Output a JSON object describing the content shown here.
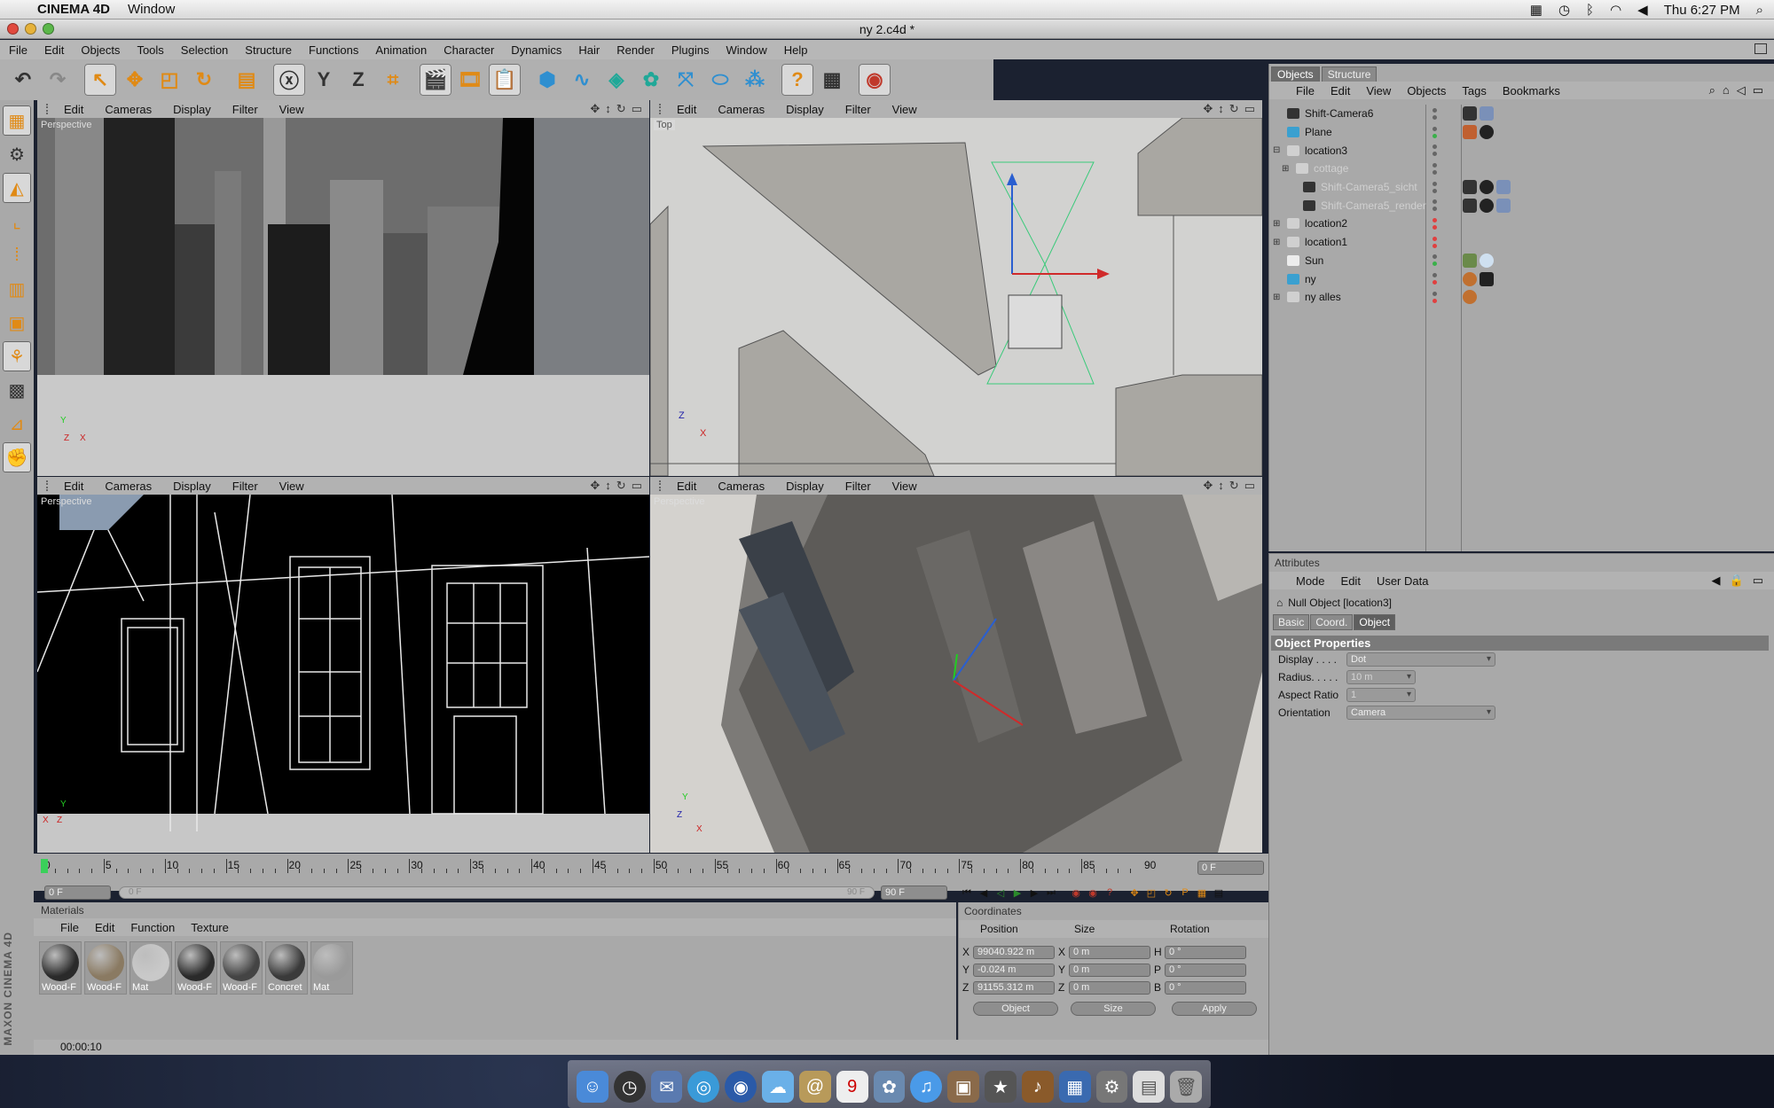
{
  "menubar": {
    "app_name": "CINEMA 4D",
    "items": [
      "Window"
    ],
    "clock": "Thu 6:27 PM"
  },
  "window": {
    "title": "ny 2.c4d *"
  },
  "app_menu": [
    "File",
    "Edit",
    "Objects",
    "Tools",
    "Selection",
    "Structure",
    "Functions",
    "Animation",
    "Character",
    "Dynamics",
    "Hair",
    "Render",
    "Plugins",
    "Window",
    "Help"
  ],
  "toolbar": {
    "axis_y": "Y",
    "axis_z": "Z"
  },
  "viewport_menu": [
    "Edit",
    "Cameras",
    "Display",
    "Filter",
    "View"
  ],
  "viewports": {
    "top_left": "Perspective",
    "top_right": "Top",
    "bottom_left": "Perspective",
    "bottom_right": "Perspective"
  },
  "objects_panel": {
    "tabs": [
      "Objects",
      "Structure"
    ],
    "menu": [
      "File",
      "Edit",
      "View",
      "Objects",
      "Tags",
      "Bookmarks"
    ],
    "items": [
      {
        "name": "Shift-Camera6",
        "indent": 0,
        "expand": "",
        "dim": false
      },
      {
        "name": "Plane",
        "indent": 0,
        "expand": "",
        "dim": false
      },
      {
        "name": "location3",
        "indent": 0,
        "expand": "⊟",
        "dim": false
      },
      {
        "name": "cottage",
        "indent": 1,
        "expand": "⊞",
        "dim": true
      },
      {
        "name": "Shift-Camera5_sicht",
        "indent": 1,
        "expand": "",
        "dim": true
      },
      {
        "name": "Shift-Camera5_render",
        "indent": 1,
        "expand": "",
        "dim": true
      },
      {
        "name": "location2",
        "indent": 0,
        "expand": "⊞",
        "dim": false
      },
      {
        "name": "location1",
        "indent": 0,
        "expand": "⊞",
        "dim": false
      },
      {
        "name": "Sun",
        "indent": 0,
        "expand": "",
        "dim": false
      },
      {
        "name": "ny",
        "indent": 0,
        "expand": "",
        "dim": false
      },
      {
        "name": "ny alles",
        "indent": 0,
        "expand": "⊞",
        "dim": false
      }
    ]
  },
  "attributes": {
    "header": "Attributes",
    "menu": [
      "Mode",
      "Edit",
      "User Data"
    ],
    "object_title": "Null Object [location3]",
    "tabs": [
      "Basic",
      "Coord.",
      "Object"
    ],
    "section": "Object Properties",
    "props": [
      {
        "label": "Display . . . .",
        "value": "Dot"
      },
      {
        "label": "Radius. . . . .",
        "value": "10 m"
      },
      {
        "label": "Aspect Ratio",
        "value": "1"
      },
      {
        "label": "Orientation",
        "value": "Camera"
      }
    ]
  },
  "timeline": {
    "ticks": [
      "0",
      "5",
      "10",
      "15",
      "20",
      "25",
      "30",
      "35",
      "40",
      "45",
      "50",
      "55",
      "60",
      "65",
      "70",
      "75",
      "80",
      "85",
      "90"
    ],
    "current_frame": "0 F",
    "start_frame": "0 F",
    "slider_start": "0 F",
    "slider_end": "90 F",
    "end_frame": "90 F"
  },
  "materials": {
    "header": "Materials",
    "menu": [
      "File",
      "Edit",
      "Function",
      "Texture"
    ],
    "items": [
      {
        "label": "Wood-F",
        "color": "#2a2a2a"
      },
      {
        "label": "Wood-F",
        "color": "#8a7a62"
      },
      {
        "label": "Mat",
        "color": "#c9c9c9"
      },
      {
        "label": "Wood-F",
        "color": "#2a2a2a"
      },
      {
        "label": "Wood-F",
        "color": "#444"
      },
      {
        "label": "Concret",
        "color": "#3a3a3a"
      },
      {
        "label": "Mat",
        "color": "#9a9a9a"
      }
    ]
  },
  "coordinates": {
    "header": "Coordinates",
    "columns": [
      "Position",
      "Size",
      "Rotation"
    ],
    "rows": [
      {
        "axis": "X",
        "pos": "99040.922 m",
        "size_axis": "X",
        "size": "0 m",
        "rot_axis": "H",
        "rot": "0 °"
      },
      {
        "axis": "Y",
        "pos": "-0.024 m",
        "size_axis": "Y",
        "size": "0 m",
        "rot_axis": "P",
        "rot": "0 °"
      },
      {
        "axis": "Z",
        "pos": "91155.312 m",
        "size_axis": "Z",
        "size": "0 m",
        "rot_axis": "B",
        "rot": "0 °"
      }
    ],
    "mode_object": "Object",
    "mode_size": "Size",
    "apply": "Apply"
  },
  "status": {
    "time": "00:00:10"
  },
  "maxon_logo": "MAXON CINEMA 4D",
  "colors": {
    "accent_orange": "#e08a15",
    "panel_gray": "#a9a9a9"
  }
}
